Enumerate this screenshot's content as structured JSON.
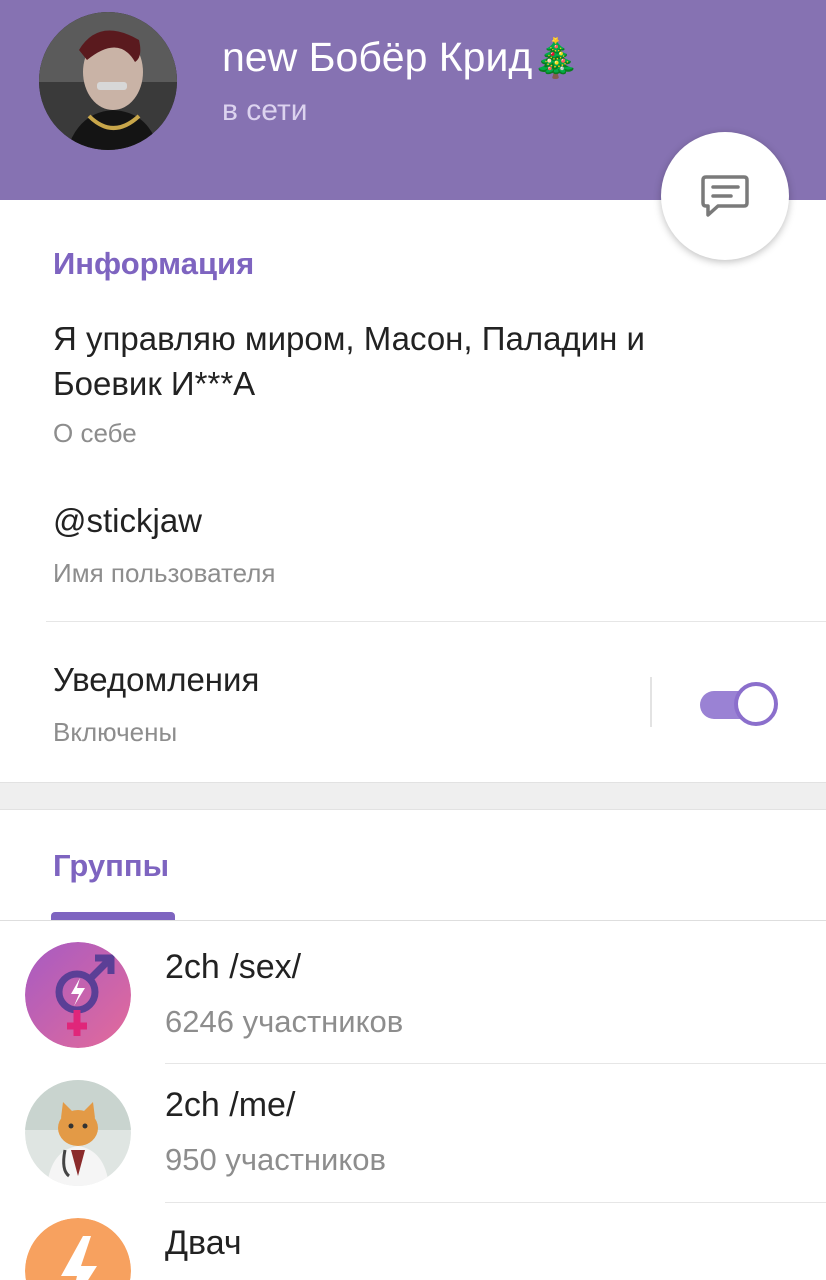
{
  "header": {
    "name": "new Бобёр Крид",
    "emoji": "🎄",
    "status": "в сети"
  },
  "info_section": {
    "title": "Информация",
    "bio": "Я управляю миром, Масон, Паладин и Боевик И***А",
    "bio_label": "О себе",
    "username": "@stickjaw",
    "username_label": "Имя пользователя"
  },
  "notifications": {
    "label": "Уведомления",
    "status": "Включены",
    "enabled": true
  },
  "groups_tab": {
    "label": "Группы"
  },
  "groups": [
    {
      "name": "2ch /sex/",
      "members": "6246 участников"
    },
    {
      "name": "2ch /me/",
      "members": "950 участников"
    },
    {
      "name": "Двач",
      "members": ""
    }
  ],
  "colors": {
    "header_bg": "#8672b2",
    "accent": "#7e64c0",
    "secondary_text": "#8d8d8d"
  }
}
